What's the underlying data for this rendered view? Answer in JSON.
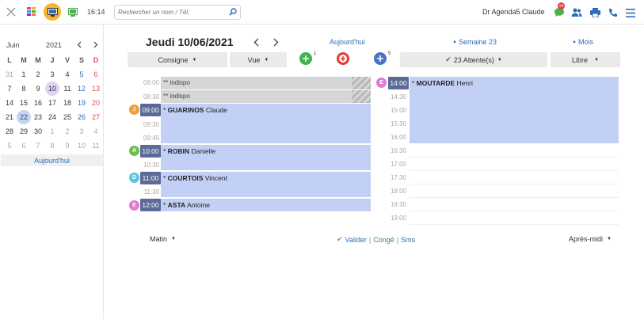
{
  "topbar": {
    "time": "16:14",
    "search_placeholder": "Rechercher un nom / Tél.",
    "user": "Dr Agenda5 Claude",
    "chat_badge": "19"
  },
  "minical": {
    "month": "Juin",
    "year": "2021",
    "weekdays": [
      "L",
      "M",
      "M",
      "J",
      "V",
      "S",
      "D"
    ],
    "rows": [
      [
        "31",
        "1",
        "2",
        "3",
        "4",
        "5",
        "6"
      ],
      [
        "7",
        "8",
        "9",
        "10",
        "11",
        "12",
        "13"
      ],
      [
        "14",
        "15",
        "16",
        "17",
        "18",
        "19",
        "20"
      ],
      [
        "21",
        "22",
        "23",
        "24",
        "25",
        "26",
        "27"
      ],
      [
        "28",
        "29",
        "30",
        "1",
        "2",
        "3",
        "4"
      ],
      [
        "5",
        "6",
        "7",
        "8",
        "9",
        "10",
        "11"
      ]
    ],
    "today_label": "Aujourd'hui"
  },
  "header": {
    "date_title": "Jeudi 10/06/2021",
    "today_link": "Aujourd'hui",
    "week_link": "Semaine 23",
    "month_link": "Mois"
  },
  "toolbar": {
    "consigne": "Consigne",
    "vue": "Vue",
    "green_count": "1",
    "blue_count": "5",
    "attentes": "23 Attente(s)",
    "libre": "Libre"
  },
  "morning": {
    "slots": [
      "08:00",
      "08:30",
      "09:00",
      "09:30",
      "09:45",
      "10:00",
      "10:30",
      "11:00",
      "11:30",
      "12:00"
    ],
    "indispo": [
      "** indispo",
      "** indispo"
    ],
    "appointments": [
      {
        "time": "09:00",
        "name": "GUARINOS",
        "first": "Claude",
        "initial": "J",
        "color": "#f0a040"
      },
      {
        "time": "10:00",
        "name": "ROBIN",
        "first": "Danielle",
        "initial": "A",
        "color": "#6cc04a"
      },
      {
        "time": "11:00",
        "name": "COURTOIS",
        "first": "Vincent",
        "initial": "D",
        "color": "#5cc6e0"
      },
      {
        "time": "12:00",
        "name": "ASTA",
        "first": "Antoine",
        "initial": "E",
        "color": "#e07ad8"
      }
    ]
  },
  "afternoon": {
    "slots": [
      "14:00",
      "14:30",
      "15:00",
      "15:30",
      "16:00",
      "16:30",
      "17:00",
      "17:30",
      "18:00",
      "18:30",
      "19:00"
    ],
    "appointment": {
      "time": "14:00",
      "name": "MOUTARDE",
      "first": "Henri",
      "initial": "E",
      "color": "#e07ad8"
    }
  },
  "footer": {
    "matin": "Matin",
    "valider": "Valider",
    "conge": "Congé",
    "sms": "Sms",
    "apres_midi": "Après-midi"
  },
  "colors": {
    "appt_bg": "#c3d0f5",
    "chip_bg": "#5b6a96",
    "accent": "#2a6eb5"
  }
}
